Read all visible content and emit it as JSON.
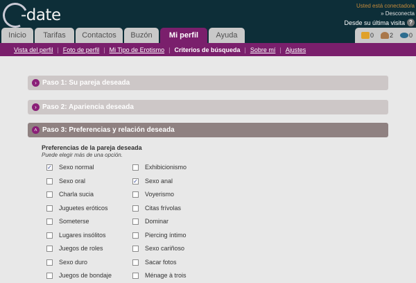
{
  "header": {
    "logo_text": "-date",
    "session_status": "Usted está conectado/a",
    "logout_label": "» Desconecta",
    "last_visit_label": "Desde su última visita",
    "help_icon": "?",
    "notifications": [
      {
        "name": "mail-icon",
        "count": "0"
      },
      {
        "name": "users-icon",
        "count": "2"
      },
      {
        "name": "eye-icon",
        "count": "0"
      }
    ]
  },
  "tabs": [
    {
      "label": "Inicio",
      "active": false
    },
    {
      "label": "Tarifas",
      "active": false
    },
    {
      "label": "Contactos",
      "active": false
    },
    {
      "label": "Buzón",
      "active": false
    },
    {
      "label": "Mi perfil",
      "active": true
    },
    {
      "label": "Ayuda",
      "active": false
    }
  ],
  "subnav": [
    {
      "label": "Vista del perfil",
      "current": false
    },
    {
      "label": "Foto de perfil",
      "current": false
    },
    {
      "label": "Mi Tipo de Erotismo",
      "current": false
    },
    {
      "label": "Criterios de búsqueda",
      "current": true
    },
    {
      "label": "Sobre mí",
      "current": false
    },
    {
      "label": "Ajustes",
      "current": false
    }
  ],
  "panels": [
    {
      "title": "Paso 1: Su pareja deseada",
      "open": false
    },
    {
      "title": "Paso 2: Apariencia deseada",
      "open": false
    },
    {
      "title": "Paso 3: Preferencias y relación deseada",
      "open": true
    }
  ],
  "preferences": {
    "title": "Preferencias de la pareja deseada",
    "subtitle": "Puede elegir más de una opción.",
    "options": [
      {
        "label": "Sexo normal",
        "checked": true
      },
      {
        "label": "Exhibicionismo",
        "checked": false
      },
      {
        "label": "Sexo oral",
        "checked": false
      },
      {
        "label": "Sexo anal",
        "checked": true
      },
      {
        "label": "Charla sucia",
        "checked": false
      },
      {
        "label": "Voyerismo",
        "checked": false
      },
      {
        "label": "Juguetes eróticos",
        "checked": false
      },
      {
        "label": "Citas frívolas",
        "checked": false
      },
      {
        "label": "Someterse",
        "checked": false
      },
      {
        "label": "Dominar",
        "checked": false
      },
      {
        "label": "Lugares insólitos",
        "checked": false
      },
      {
        "label": "Piercing íntimo",
        "checked": false
      },
      {
        "label": "Juegos de roles",
        "checked": false
      },
      {
        "label": "Sexo cariñoso",
        "checked": false
      },
      {
        "label": "Sexo duro",
        "checked": false
      },
      {
        "label": "Sacar fotos",
        "checked": false
      },
      {
        "label": "Juegos de bondaje",
        "checked": false
      },
      {
        "label": "Ménage à trois",
        "checked": false
      }
    ]
  }
}
